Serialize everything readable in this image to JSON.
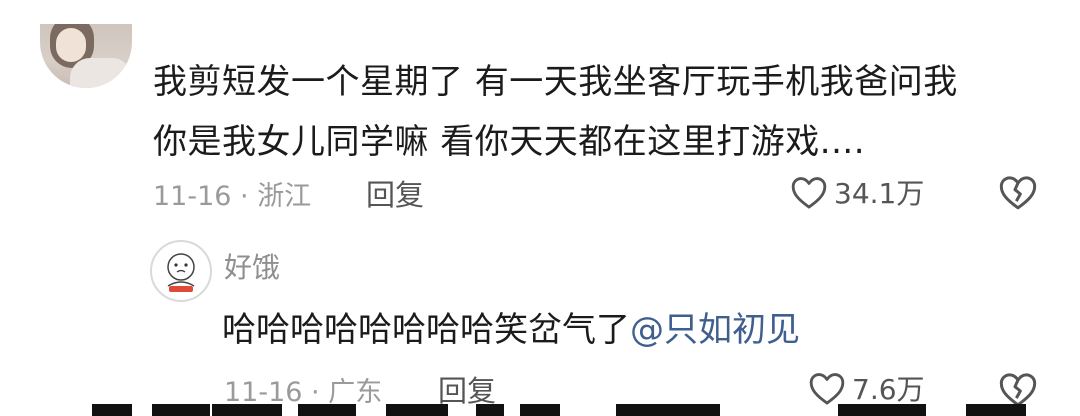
{
  "comment": {
    "text_line1": "我剪短发一个星期了 有一天我坐客厅玩手机我爸问我",
    "text_line2": "你是我女儿同学嘛 看你天天都在这里打游戏....",
    "meta": "11-16 · 浙江",
    "reply_label": "回复",
    "likes": "34.1万"
  },
  "reply": {
    "username": "好饿",
    "text": "哈哈哈哈哈哈哈哈笑岔气了",
    "mention": "@只如初见",
    "meta": "11-16 · 广东",
    "reply_label": "回复",
    "likes": "7.6万"
  },
  "colors": {
    "text": "#1b1b1b",
    "meta": "#9a9a9a",
    "mention": "#3f5f8f"
  },
  "icons": [
    "heart-outline-icon",
    "broken-heart-icon"
  ]
}
